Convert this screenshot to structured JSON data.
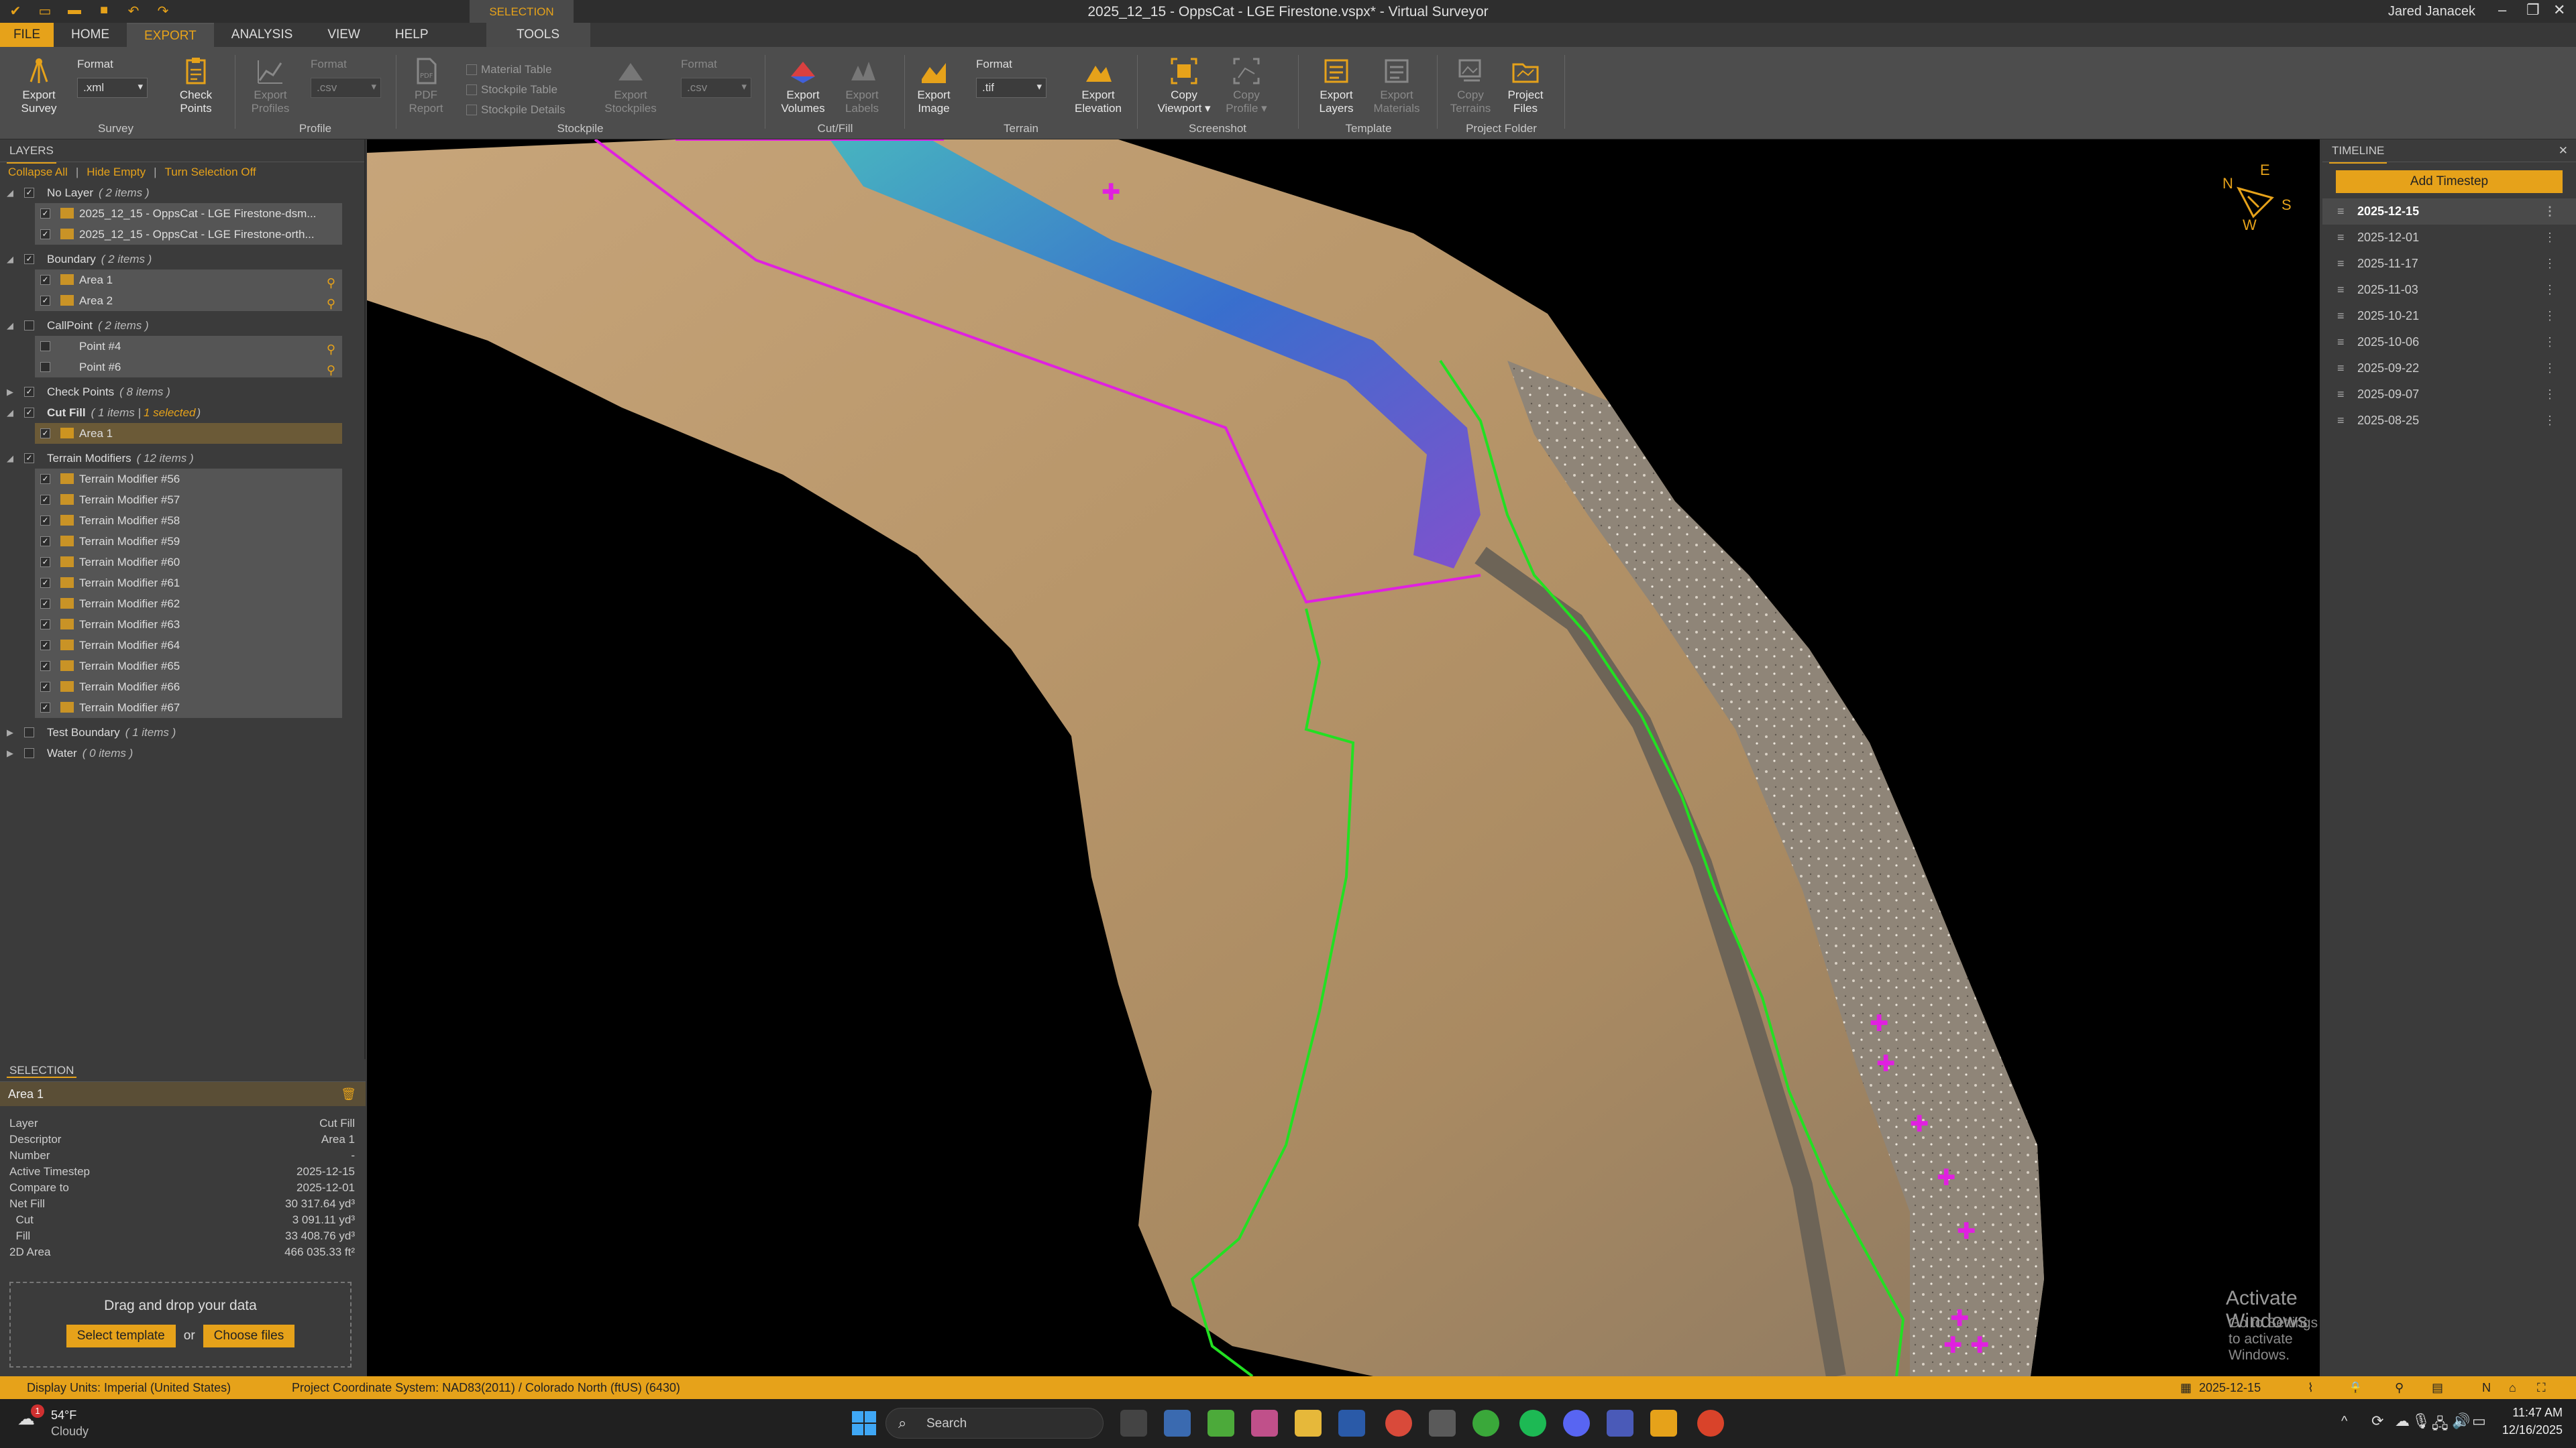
{
  "titlebar": {
    "title": "2025_12_15 - OppsCat - LGE Firestone.vspx* - Virtual Surveyor",
    "user": "Jared Janacek",
    "selection_context": "SELECTION"
  },
  "tabs": {
    "file": "FILE",
    "home": "HOME",
    "export": "EXPORT",
    "analysis": "ANALYSIS",
    "view": "VIEW",
    "help": "HELP",
    "tools": "TOOLS"
  },
  "ribbon": {
    "survey": {
      "label": "Survey",
      "export_survey": "Export Survey",
      "format_label": "Format",
      "format_value": ".xml",
      "check_points": "Check Points"
    },
    "profile": {
      "label": "Profile",
      "export_profiles": "Export Profiles",
      "format_label": "Format",
      "format_value": ".csv"
    },
    "stockpile": {
      "label": "Stockpile",
      "pdf_report": "PDF Report",
      "material_table": "Material Table",
      "stockpile_table": "Stockpile Table",
      "stockpile_details": "Stockpile Details",
      "export_stockpiles": "Export Stockpiles",
      "format_label": "Format",
      "format_value": ".csv"
    },
    "cutfill": {
      "label": "Cut/Fill",
      "export_volumes": "Export Volumes",
      "export_labels": "Export Labels"
    },
    "terrain": {
      "label": "Terrain",
      "export_image": "Export Image",
      "format_label": "Format",
      "format_value": ".tif",
      "export_elevation": "Export Elevation"
    },
    "screenshot": {
      "label": "Screenshot",
      "copy_viewport": "Copy Viewport ▾",
      "copy_profile": "Copy Profile ▾"
    },
    "template": {
      "label": "Template",
      "export_layers": "Export Layers",
      "export_materials": "Export Materials"
    },
    "project_folder": {
      "label": "Project Folder",
      "copy_terrains": "Copy Terrains",
      "project_files": "Project Files"
    }
  },
  "layers": {
    "header": "LAYERS",
    "collapse_all": "Collapse All",
    "hide_empty": "Hide Empty",
    "turn_selection_off": "Turn Selection Off",
    "groups": [
      {
        "name": "No Layer",
        "count": "( 2 items )",
        "items": [
          "2025_12_15 - OppsCat - LGE Firestone-dsm...",
          "2025_12_15 - OppsCat - LGE Firestone-orth..."
        ]
      },
      {
        "name": "Boundary",
        "count": "( 2 items )",
        "items": [
          "Area 1",
          "Area 2"
        ]
      },
      {
        "name": "CallPoint",
        "count": "( 2 items )",
        "items": [
          "Point #4",
          "Point #6"
        ]
      },
      {
        "name": "Check Points",
        "count": "( 8 items )",
        "items": []
      },
      {
        "name": "Cut Fill",
        "count": "( 1 items |",
        "selected": "1 selected",
        "items": [
          "Area 1"
        ]
      },
      {
        "name": "Terrain Modifiers",
        "count": "( 12 items )",
        "items": [
          "Terrain Modifier #56",
          "Terrain Modifier #57",
          "Terrain Modifier #58",
          "Terrain Modifier #59",
          "Terrain Modifier #60",
          "Terrain Modifier #61",
          "Terrain Modifier #62",
          "Terrain Modifier #63",
          "Terrain Modifier #64",
          "Terrain Modifier #65",
          "Terrain Modifier #66",
          "Terrain Modifier #67"
        ]
      },
      {
        "name": "Test Boundary",
        "count": "( 1 items )",
        "items": []
      },
      {
        "name": "Water",
        "count": "( 0 items )",
        "items": []
      }
    ]
  },
  "selection": {
    "header": "SELECTION",
    "title": "Area 1",
    "props": [
      {
        "k": "Layer",
        "v": "Cut Fill"
      },
      {
        "k": "Descriptor",
        "v": "Area 1"
      },
      {
        "k": "Number",
        "v": "-"
      },
      {
        "k": "Active Timestep",
        "v": "2025-12-15"
      },
      {
        "k": "Compare to",
        "v": "2025-12-01"
      },
      {
        "k": "Net Fill",
        "v": "30 317.64 yd³"
      },
      {
        "k": "  Cut",
        "v": "3 091.11 yd³"
      },
      {
        "k": "  Fill",
        "v": "33 408.76 yd³"
      },
      {
        "k": "2D Area",
        "v": "466 035.33 ft²"
      }
    ],
    "drop_text": "Drag and drop your data",
    "select_template": "Select template",
    "or": "or",
    "choose_files": "Choose files"
  },
  "timeline": {
    "header": "TIMELINE",
    "add": "Add Timestep",
    "steps": [
      "2025-12-15",
      "2025-12-01",
      "2025-11-17",
      "2025-11-03",
      "2025-10-21",
      "2025-10-06",
      "2025-09-22",
      "2025-09-07",
      "2025-08-25"
    ]
  },
  "compass": {
    "n": "N",
    "e": "E",
    "s": "S",
    "w": "W"
  },
  "watermark": {
    "line1": "Activate Windows",
    "line2": "Go to Settings to activate Windows."
  },
  "status": {
    "display_units": "Display Units:  Imperial (United States)",
    "crs": "Project Coordinate System:  NAD83(2011) / Colorado North (ftUS) (6430)",
    "timestep": "2025-12-15"
  },
  "taskbar": {
    "temp": "54°F",
    "weather": "Cloudy",
    "search": "Search",
    "time": "11:47 AM",
    "date": "12/16/2025",
    "badge": "1"
  }
}
